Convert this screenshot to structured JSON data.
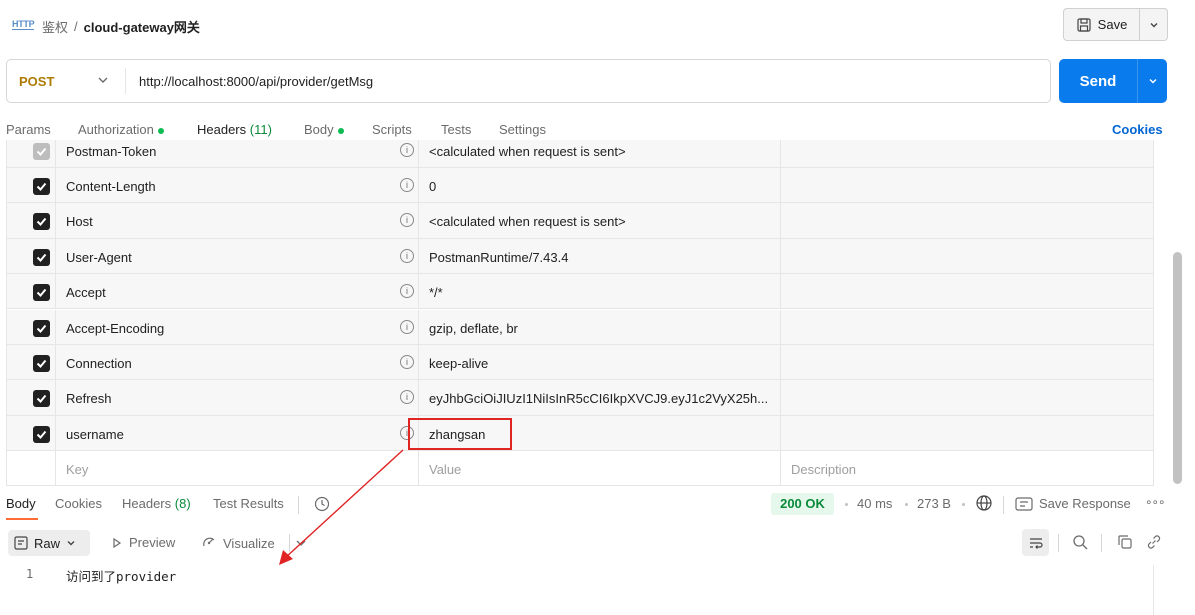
{
  "header": {
    "http_badge": "HTTP",
    "breadcrumb_parent": "鉴权",
    "breadcrumb_sep": "/",
    "breadcrumb_current": "cloud-gateway网关",
    "save_label": "Save"
  },
  "request": {
    "method": "POST",
    "url": "http://localhost:8000/api/provider/getMsg",
    "send_label": "Send"
  },
  "request_tabs": {
    "params": "Params",
    "authorization": "Authorization",
    "headers": "Headers",
    "headers_count": "(11)",
    "body": "Body",
    "scripts": "Scripts",
    "tests": "Tests",
    "settings": "Settings",
    "cookies": "Cookies"
  },
  "headers_table": {
    "rows": [
      {
        "key": "Postman-Token",
        "value": "<calculated when request is sent>"
      },
      {
        "key": "Content-Length",
        "value": "0"
      },
      {
        "key": "Host",
        "value": "<calculated when request is sent>"
      },
      {
        "key": "User-Agent",
        "value": "PostmanRuntime/7.43.4"
      },
      {
        "key": "Accept",
        "value": "*/*"
      },
      {
        "key": "Accept-Encoding",
        "value": "gzip, deflate, br"
      },
      {
        "key": "Connection",
        "value": "keep-alive"
      },
      {
        "key": "Refresh",
        "value": "eyJhbGciOiJIUzI1NiIsInR5cCI6IkpXVCJ9.eyJ1c2VyX25h..."
      },
      {
        "key": "username",
        "value": "zhangsan"
      }
    ],
    "placeholder": {
      "key": "Key",
      "value": "Value",
      "description": "Description"
    }
  },
  "response_tabs": {
    "body": "Body",
    "cookies": "Cookies",
    "headers": "Headers",
    "headers_count": "(8)",
    "test_results": "Test Results"
  },
  "response_meta": {
    "status": "200 OK",
    "time": "40 ms",
    "size": "273 B",
    "save_response": "Save Response"
  },
  "response_toolbar": {
    "format": "Raw",
    "preview": "Preview",
    "visualize": "Visualize"
  },
  "response_body": {
    "line_number": "1",
    "line_text": "访问到了provider"
  },
  "colors": {
    "accent": "#ff6c37",
    "send": "#097bed",
    "method": "#ad7a03",
    "status_ok": "#0a8a3a",
    "annotation": "#e02424"
  }
}
